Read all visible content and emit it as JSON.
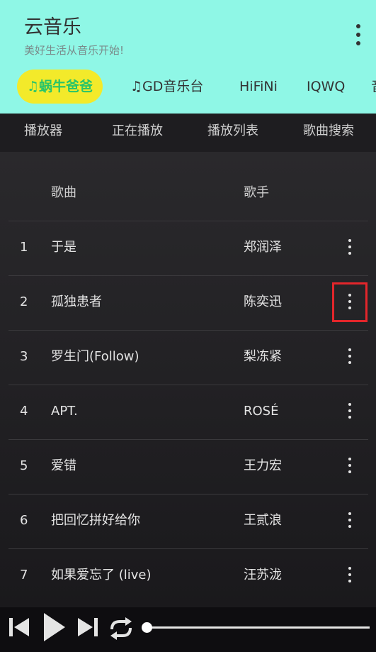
{
  "app": {
    "title": "云音乐",
    "subtitle": "美好生活从音乐开始!"
  },
  "sources": [
    {
      "label": "♫蜗牛爸爸",
      "active": true
    },
    {
      "label": "♫GD音乐台",
      "active": false
    },
    {
      "label": "HiFiNi",
      "active": false
    },
    {
      "label": "IQWQ",
      "active": false
    },
    {
      "label": "音",
      "active": false
    }
  ],
  "nav": {
    "tabs": [
      "播放器",
      "正在播放",
      "播放列表",
      "歌曲搜索"
    ]
  },
  "table": {
    "columns": {
      "song": "歌曲",
      "artist": "歌手"
    },
    "rows": [
      {
        "num": "1",
        "song": "于是",
        "artist": "郑润泽"
      },
      {
        "num": "2",
        "song": "孤独患者",
        "artist": "陈奕迅"
      },
      {
        "num": "3",
        "song": "罗生门(Follow)",
        "artist": "梨冻紧"
      },
      {
        "num": "4",
        "song": "APT.",
        "artist": "ROSÉ"
      },
      {
        "num": "5",
        "song": "爱错",
        "artist": "王力宏"
      },
      {
        "num": "6",
        "song": "把回忆拼好给你",
        "artist": "王贰浪"
      },
      {
        "num": "7",
        "song": "如果爱忘了 (live)",
        "artist": "汪苏泷"
      }
    ]
  },
  "player": {
    "progress": 0,
    "icons": [
      "previous-icon",
      "play-icon",
      "next-icon",
      "repeat-icon"
    ]
  },
  "colors": {
    "header_bg": "#8ff7e6",
    "active_tab_bg": "#f3ea2a",
    "active_tab_text": "#27c46a",
    "highlight": "#e3262b"
  }
}
